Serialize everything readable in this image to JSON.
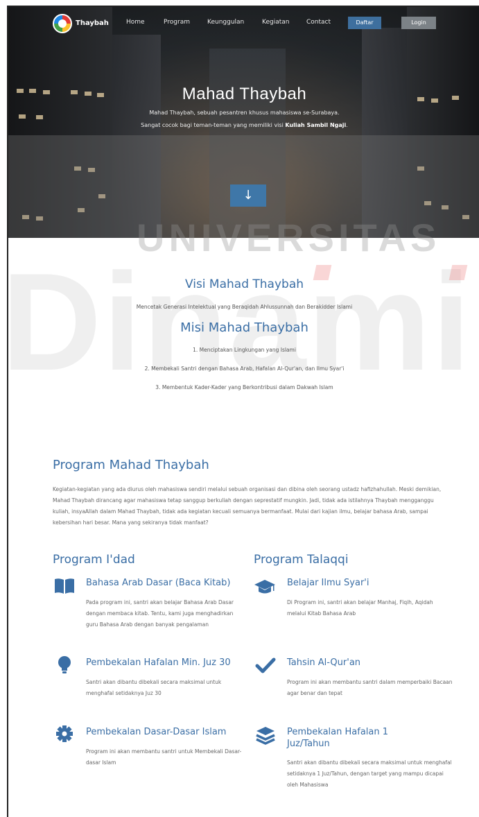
{
  "nav": {
    "brand": "Thaybah",
    "links": [
      "Home",
      "Program",
      "Keunggulan",
      "Kegiatan",
      "Contact"
    ],
    "register": "Daftar",
    "login": "Login"
  },
  "hero": {
    "title": "Mahad Thaybah",
    "subtitle_1": "Mahad Thaybah, sebuah pesantren khusus mahasiswa se-Surabaya.",
    "subtitle_2_prefix": "Sangat cocok bagi teman-teman yang memiliki visi ",
    "subtitle_2_bold": "Kuliah Sambil Ngaji",
    "subtitle_2_suffix": ".",
    "scroll_icon": "arrow-down-icon"
  },
  "watermark": {
    "line1": "UNIVERSITAS",
    "line2": "Dinamika"
  },
  "visi": {
    "title": "Visi Mahad Thaybah",
    "text": "Mencetak Generasi Intelektual yang Beraqidah Ahlussunnah dan Berakidder Islami"
  },
  "misi": {
    "title": "Misi Mahad Thaybah",
    "items": [
      "1. Menciptakan Lingkungan yang Islami",
      "2. Membekali Santri dengan Bahasa Arab, Hafalan Al-Qur'an, dan Ilmu Syar'i",
      "3. Membentuk Kader-Kader yang Berkontribusi dalam Dakwah Islam"
    ]
  },
  "program": {
    "title": "Program Mahad Thaybah",
    "text": "Kegiatan-kegiatan yang ada diurus oleh mahasiswa sendiri melalui sebuah organisasi dan dibina oleh seorang ustadz hafizhahullah. Meski demikian, Mahad Thaybah dirancang agar mahasiswa tetap sanggup berkuliah dengan seprestatif mungkin. Jadi, tidak ada istilahnya Thaybah mengganggu kuliah, insyaAllah dalam Mahad Thaybah, tidak ada kegiatan kecuali semuanya bermanfaat. Mulai dari kajian ilmu, belajar bahasa Arab, sampai kebersihan hari besar. Mana yang sekiranya tidak manfaat?"
  },
  "idad": {
    "title": "Program I'dad",
    "items": [
      {
        "icon": "book-icon",
        "title": "Bahasa Arab Dasar (Baca Kitab)",
        "text": "Pada program ini, santri akan belajar Bahasa Arab Dasar dengan membaca kitab. Tentu, kami juga menghadirkan guru Bahasa Arab dengan banyak pengalaman"
      },
      {
        "icon": "lightbulb-icon",
        "title": "Pembekalan Hafalan Min. Juz 30",
        "text": "Santri akan dibantu dibekali secara maksimal untuk menghafal setidaknya Juz 30"
      },
      {
        "icon": "gear-icon",
        "title": "Pembekalan Dasar-Dasar Islam",
        "text": "Program ini akan membantu santri untuk Membekali Dasar-dasar Islam"
      }
    ]
  },
  "talaqqi": {
    "title": "Program Talaqqi",
    "items": [
      {
        "icon": "graduation-cap-icon",
        "title": "Belajar Ilmu Syar'i",
        "text": "Di Program ini, santri akan belajar Manhaj, Fiqih, Aqidah melalui Kitab Bahasa Arab"
      },
      {
        "icon": "check-icon",
        "title": "Tahsin Al-Qur'an",
        "text": "Program ini akan membantu santri dalam memperbaiki Bacaan agar benar dan tepat"
      },
      {
        "icon": "layers-icon",
        "title_1": "Pembekalan Hafalan 1",
        "title_2": "Juz/Tahun",
        "text": "Santri akan dibantu dibekali secara maksimal untuk menghafal setidaknya 1 Juz/Tahun, dengan target yang mampu dicapai oleh Mahasiswa"
      }
    ]
  },
  "colors": {
    "accent": "#3a6ea5",
    "register_btn": "#3e6f9e",
    "login_btn": "#7c8287"
  }
}
